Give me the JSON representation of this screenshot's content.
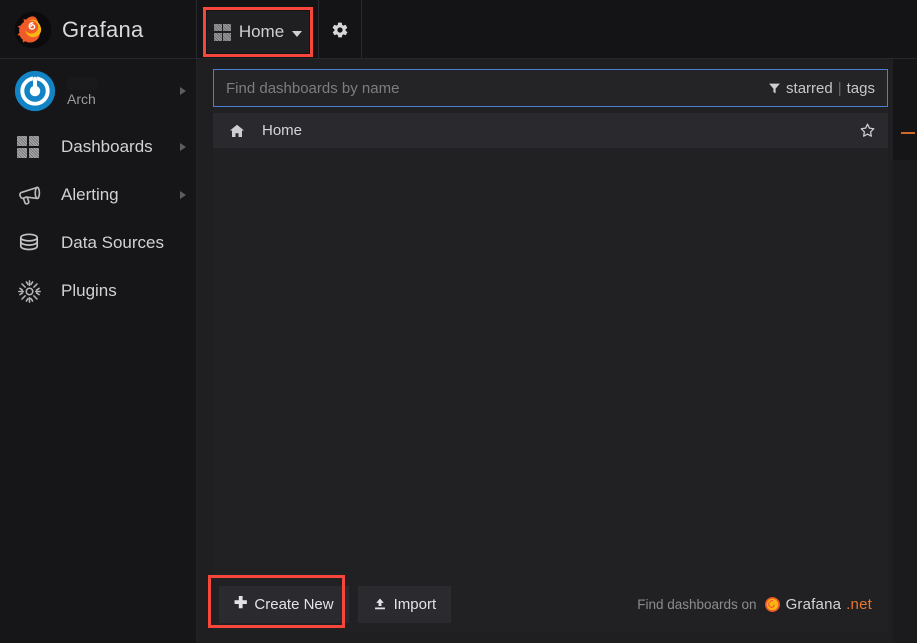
{
  "app": {
    "brand_name": "Grafana",
    "brand_logo_icon": "grafana-flame-logo"
  },
  "topbar": {
    "home_button": {
      "label": "Home",
      "icon": "dashboard-grid-icon",
      "caret_icon": "chevron-down-icon",
      "highlighted": true
    },
    "settings_button": {
      "icon": "gear-icon",
      "label": ""
    }
  },
  "sidebar": {
    "profile": {
      "avatar_icon": "user-avatar-gravatar",
      "username_redacted": "",
      "org_name": "Arch",
      "expand_icon": "chevron-right-icon"
    },
    "items": [
      {
        "label": "Dashboards",
        "icon": "dashboard-grid-icon",
        "has_submenu": true
      },
      {
        "label": "Alerting",
        "icon": "bullhorn-icon",
        "has_submenu": true
      },
      {
        "label": "Data Sources",
        "icon": "database-icon",
        "has_submenu": false
      },
      {
        "label": "Plugins",
        "icon": "plugin-icon",
        "has_submenu": false
      }
    ]
  },
  "search_panel": {
    "search": {
      "placeholder": "Find dashboards by name",
      "value": ""
    },
    "filters": {
      "filter_icon": "filter-funnel-icon",
      "starred_label": "starred",
      "separator": "|",
      "tags_label": "tags"
    },
    "results": [
      {
        "label": "Home",
        "icon": "home-icon",
        "star_icon": "star-outline-icon",
        "starred": false
      }
    ],
    "actions": {
      "create_new_label": "Create New",
      "create_new_icon": "plus-icon",
      "create_new_highlighted": true,
      "import_label": "Import",
      "import_icon": "upload-icon"
    },
    "promo": {
      "text": "Find dashboards on",
      "brand_icon": "grafana-net-logo",
      "brand_name": "Grafana",
      "brand_tld": ".net"
    }
  },
  "colors": {
    "accent_red_highlight": "#f7473c",
    "search_border_blue": "#4a7fd1",
    "brand_orange": "#e8762d",
    "panel_bg": "#212124",
    "sidebar_bg": "#161618"
  }
}
